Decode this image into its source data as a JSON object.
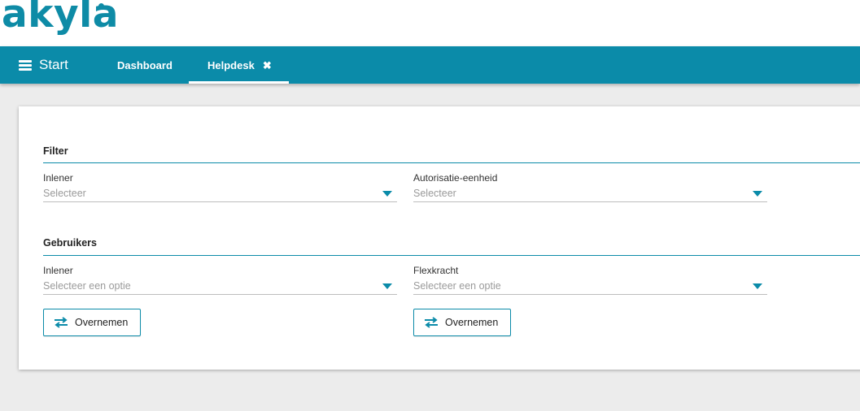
{
  "brand": {
    "logo_text": "akyla",
    "color": "#0e8ba6"
  },
  "navbar": {
    "color": "#0b8ba9",
    "menu_label": "Start",
    "tabs": [
      {
        "label": "Dashboard",
        "active": false
      },
      {
        "label": "Helpdesk",
        "active": true,
        "closable": true
      }
    ]
  },
  "filter": {
    "title": "Filter",
    "fields": [
      {
        "label": "Inlener",
        "placeholder": "Selecteer"
      },
      {
        "label": "Autorisatie-eenheid",
        "placeholder": "Selecteer"
      }
    ]
  },
  "users": {
    "title": "Gebruikers",
    "fields": [
      {
        "label": "Inlener",
        "placeholder": "Selecteer een optie"
      },
      {
        "label": "Flexkracht",
        "placeholder": "Selecteer een optie"
      }
    ],
    "buttons": [
      {
        "label": "Overnemen",
        "icon": "swap-arrows-icon"
      },
      {
        "label": "Overnemen",
        "icon": "swap-arrows-icon"
      }
    ]
  }
}
